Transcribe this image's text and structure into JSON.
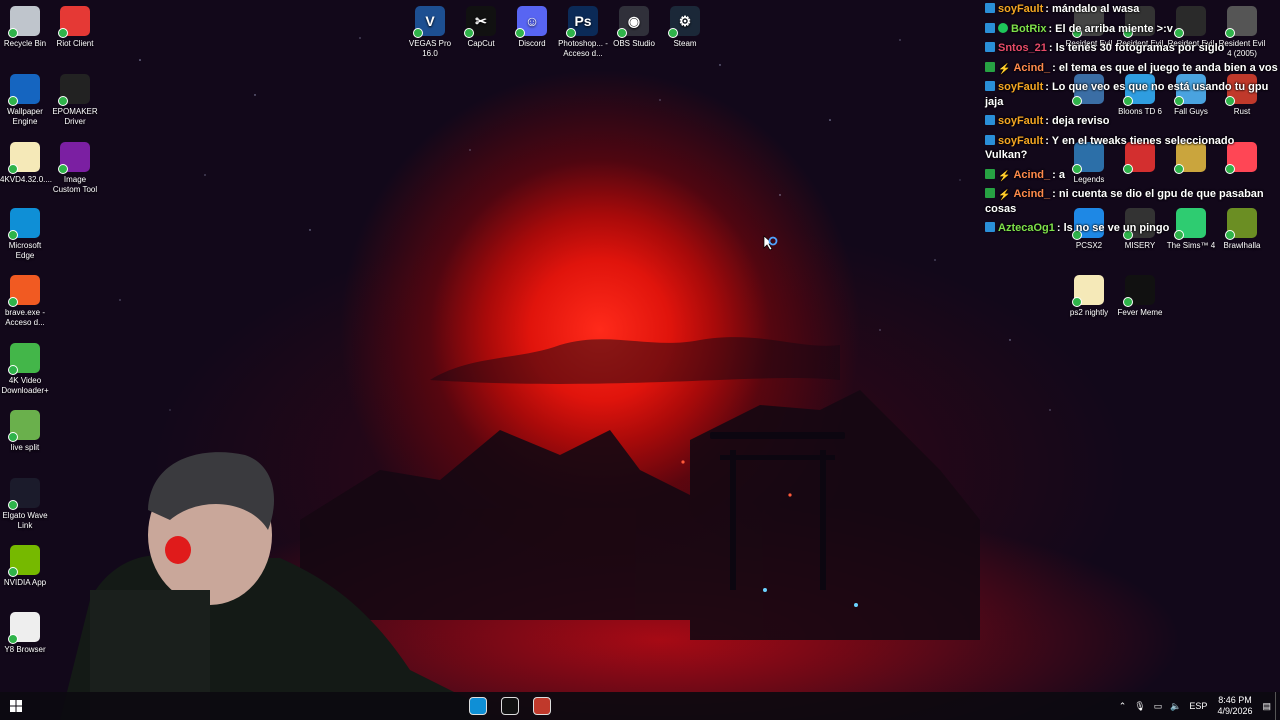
{
  "desktop": {
    "left_icons": [
      {
        "label": "Recycle Bin",
        "icon": "recycle-bin-icon",
        "color": "#bfc5cc"
      },
      {
        "label": "Riot Client",
        "icon": "riot-client-icon",
        "color": "#e53935"
      },
      {
        "label": "Wallpaper Engine",
        "icon": "wallpaper-engine-icon",
        "color": "#1565c0"
      },
      {
        "label": "EPOMAKER Driver",
        "icon": "epomaker-driver-icon",
        "color": "#222222"
      },
      {
        "label": "4KVD4.32.0....",
        "icon": "file-icon",
        "color": "#f5e9b8"
      },
      {
        "label": "Image Custom Tool",
        "icon": "image-custom-tool-icon",
        "color": "#7b1fa2"
      },
      {
        "label": "Microsoft Edge",
        "icon": "edge-icon",
        "color": "#0f8fd6"
      },
      {
        "label": "brave.exe - Acceso d...",
        "icon": "brave-icon",
        "color": "#f15a22"
      },
      {
        "label": "4K Video Downloader+",
        "icon": "4k-video-downloader-icon",
        "color": "#43b649"
      },
      {
        "label": "live split",
        "icon": "livesplit-icon",
        "color": "#6ab04c"
      },
      {
        "label": "Elgato Wave Link",
        "icon": "elgato-wave-link-icon",
        "color": "#1b1b2b"
      },
      {
        "label": "NVIDIA App",
        "icon": "nvidia-icon",
        "color": "#76b900"
      },
      {
        "label": "Y8 Browser",
        "icon": "y8-browser-icon",
        "color": "#eeeeee"
      }
    ],
    "top_icons": [
      {
        "label": "VEGAS Pro 16.0",
        "icon": "vegas-pro-icon",
        "glyph": "V",
        "color": "#1d4f91"
      },
      {
        "label": "CapCut",
        "icon": "capcut-icon",
        "glyph": "✂",
        "color": "#111111"
      },
      {
        "label": "Discord",
        "icon": "discord-icon",
        "glyph": "☺",
        "color": "#5865f2"
      },
      {
        "label": "Photoshop... - Acceso d...",
        "icon": "photoshop-icon",
        "glyph": "Ps",
        "color": "#0b2a57"
      },
      {
        "label": "OBS Studio",
        "icon": "obs-studio-icon",
        "glyph": "◉",
        "color": "#30303a"
      },
      {
        "label": "Steam",
        "icon": "steam-icon",
        "glyph": "⚙",
        "color": "#1b2838"
      }
    ],
    "right_icons": [
      {
        "label": "Resident Evil",
        "icon": "resident-evil-icon",
        "color": "#444444"
      },
      {
        "label": "Resident Evil",
        "icon": "resident-evil-icon",
        "color": "#333333"
      },
      {
        "label": "Resident Evil",
        "icon": "resident-evil-icon",
        "color": "#2a2a2a"
      },
      {
        "label": "Resident Evil 4 (2005)",
        "icon": "resident-evil-4-icon",
        "color": "#555555"
      },
      {
        "label": "",
        "icon": "game-icon",
        "color": "#3b6ea5"
      },
      {
        "label": "Bloons TD 6",
        "icon": "bloons-td6-icon",
        "color": "#2f9de0"
      },
      {
        "label": "Fall Guys",
        "icon": "fall-guys-icon",
        "color": "#4aa3df"
      },
      {
        "label": "Rust",
        "icon": "rust-icon",
        "color": "#c0392b"
      },
      {
        "label": "Legends",
        "icon": "legends-icon",
        "color": "#2c6fa8"
      },
      {
        "label": "",
        "icon": "among-us-icon",
        "color": "#d32f2f"
      },
      {
        "label": "",
        "icon": "game-icon",
        "color": "#caa53d"
      },
      {
        "label": "",
        "icon": "valorant-icon",
        "color": "#ff4655"
      },
      {
        "label": "PCSX2",
        "icon": "pcsx2-icon",
        "color": "#1e88e5"
      },
      {
        "label": "MISERY",
        "icon": "misery-icon",
        "color": "#333333"
      },
      {
        "label": "The Sims™ 4",
        "icon": "sims-icon",
        "color": "#2ecc71"
      },
      {
        "label": "Brawlhalla",
        "icon": "brawlhalla-icon",
        "color": "#6b8e23"
      },
      {
        "label": "ps2 nightly",
        "icon": "file-icon",
        "color": "#f5e9b8"
      },
      {
        "label": "Fever Meme",
        "icon": "fever-meme-icon",
        "color": "#111111"
      }
    ]
  },
  "chat": [
    {
      "user": "soyFault",
      "user_color": "#f5a623",
      "badge": "prime",
      "text": ": mándalo al wasa"
    },
    {
      "user": "BotRix",
      "user_color": "#7ee04a",
      "badge": "prime",
      "badge2": "mod",
      "text": ": El de arriba miente >:v"
    },
    {
      "user": "Sntos_21",
      "user_color": "#e84b6a",
      "badge": "prime",
      "text": ": ls tenés 30 fotogramas por siglo"
    },
    {
      "user": "Acind_",
      "user_color": "#ff8a4c",
      "badge": "edit",
      "badge2": "bolt",
      "text": ": el tema es que el juego te anda bien a vos"
    },
    {
      "user": "soyFault",
      "user_color": "#f5a623",
      "badge": "prime",
      "text": ": Lo que veo es que no está usando tu gpu jaja"
    },
    {
      "user": "soyFault",
      "user_color": "#f5a623",
      "badge": "prime",
      "text": ": deja reviso"
    },
    {
      "user": "soyFault",
      "user_color": "#f5a623",
      "badge": "prime",
      "text": ": Y en el tweaks tienes seleccionado Vulkan?"
    },
    {
      "user": "Acind_",
      "user_color": "#ff8a4c",
      "badge": "edit",
      "badge2": "bolt",
      "text": ": a"
    },
    {
      "user": "Acind_",
      "user_color": "#ff8a4c",
      "badge": "edit",
      "badge2": "bolt",
      "text": ": ni cuenta se dio el gpu de que pasaban cosas"
    },
    {
      "user": "AztecaOg1",
      "user_color": "#7ee04a",
      "badge": "prime",
      "text": ": ls no se ve un pingo"
    }
  ],
  "taskbar": {
    "start_icon": "windows-start-icon",
    "apps": [
      {
        "icon": "edge-icon",
        "color": "#0f8fd6"
      },
      {
        "icon": "capcut-icon",
        "color": "#111111"
      },
      {
        "icon": "obs-studio-icon",
        "color": "#c0392b"
      }
    ],
    "language": "ESP",
    "time": "8:46 PM",
    "date": "4/9/2026"
  }
}
